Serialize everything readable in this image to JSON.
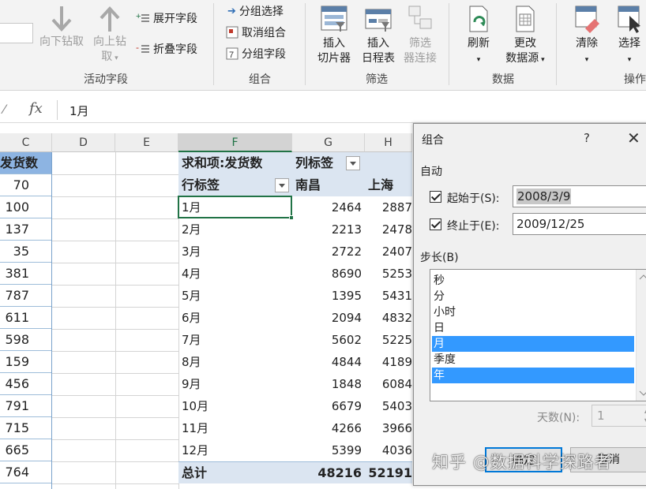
{
  "ribbon": {
    "drill_down": "向下钻取",
    "drill_up_line1": "向上钻",
    "drill_up_line2": "取",
    "expand_field": "展开字段",
    "collapse_field": "折叠字段",
    "group_active_field_label": "活动字段",
    "group_selection": "分组选择",
    "ungroup": "取消组合",
    "group_field": "分组字段",
    "group_group_label": "组合",
    "insert_slicer_1": "插入",
    "insert_slicer_2": "切片器",
    "insert_timeline_1": "插入",
    "insert_timeline_2": "日程表",
    "filter_conn_1": "筛选",
    "filter_conn_2": "器连接",
    "group_filter_label": "筛选",
    "refresh": "刷新",
    "change_source_1": "更改",
    "change_source_2": "数据源",
    "group_data_label": "数据",
    "clear": "清除",
    "select": "选择",
    "group_actions_label": "操作"
  },
  "formula_bar": {
    "fx": "fx",
    "value": "1月"
  },
  "columns": {
    "C": "C",
    "D": "D",
    "E": "E",
    "F": "F",
    "G": "G",
    "H": "H"
  },
  "col_c": {
    "header": "发货数",
    "values": [
      "70",
      "100",
      "137",
      "35",
      "381",
      "787",
      "611",
      "598",
      "159",
      "456",
      "791",
      "715",
      "665",
      "764"
    ]
  },
  "pivot": {
    "sum_label": "求和项:发货数",
    "col_labels": "列标签",
    "row_labels": "行标签",
    "col1": "南昌",
    "col2": "上海",
    "rows": [
      {
        "label": "1月",
        "v1": "2464",
        "v2": "2887"
      },
      {
        "label": "2月",
        "v1": "2213",
        "v2": "2478"
      },
      {
        "label": "3月",
        "v1": "2722",
        "v2": "2407"
      },
      {
        "label": "4月",
        "v1": "8690",
        "v2": "5253"
      },
      {
        "label": "5月",
        "v1": "1395",
        "v2": "5431"
      },
      {
        "label": "6月",
        "v1": "2094",
        "v2": "4832"
      },
      {
        "label": "7月",
        "v1": "5602",
        "v2": "5225"
      },
      {
        "label": "8月",
        "v1": "4844",
        "v2": "4189"
      },
      {
        "label": "9月",
        "v1": "1848",
        "v2": "6084"
      },
      {
        "label": "10月",
        "v1": "6679",
        "v2": "5403"
      },
      {
        "label": "11月",
        "v1": "4266",
        "v2": "3966"
      },
      {
        "label": "12月",
        "v1": "5399",
        "v2": "4036"
      }
    ],
    "total_label": "总计",
    "total1": "48216",
    "total2": "52191"
  },
  "dialog": {
    "title": "组合",
    "help": "?",
    "close": "✕",
    "auto": "自动",
    "start_label": "起始于(S):",
    "start_value": "2008/3/9",
    "end_label": "终止于(E):",
    "end_value": "2009/12/25",
    "step_label": "步长(B)",
    "items": [
      "秒",
      "分",
      "小时",
      "日",
      "月",
      "季度",
      "年"
    ],
    "days_label": "天数(N):",
    "days_value": "1",
    "ok": "确定",
    "cancel": "取消"
  },
  "watermark": "知乎 @数据科学探路者",
  "colors": {
    "accent": "#217346",
    "selection": "#3399ff",
    "header_blue": "#8db4e2",
    "pivot_header": "#dbe5f1"
  }
}
